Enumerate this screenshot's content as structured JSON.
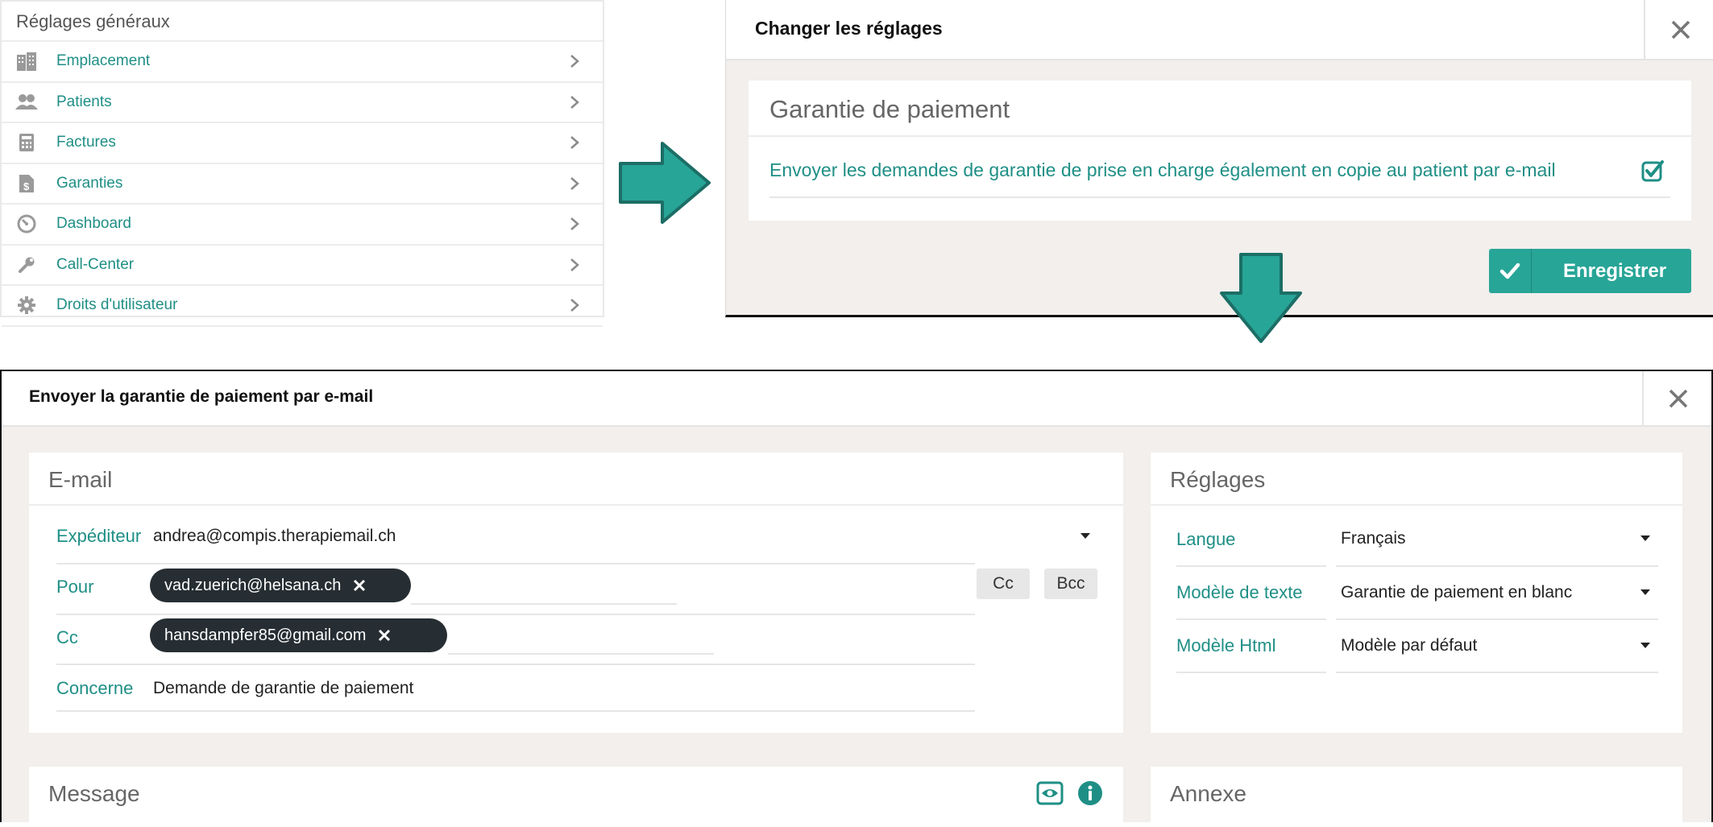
{
  "settings_list": {
    "header": "Réglages généraux",
    "items": [
      {
        "label": "Emplacement",
        "icon": "building-icon"
      },
      {
        "label": "Patients",
        "icon": "users-icon"
      },
      {
        "label": "Factures",
        "icon": "calculator-icon"
      },
      {
        "label": "Garanties",
        "icon": "document-dollar-icon"
      },
      {
        "label": "Dashboard",
        "icon": "dashboard-icon"
      },
      {
        "label": "Call-Center",
        "icon": "wrench-icon"
      },
      {
        "label": "Droits d'utilisateur",
        "icon": "gear-icon"
      }
    ]
  },
  "change_settings_modal": {
    "title": "Changer les réglages",
    "panel_title": "Garantie de paiement",
    "option_label": "Envoyer les demandes de garantie de prise en charge également en copie au patient par e-mail",
    "option_checked": true,
    "save_label": "Enregistrer"
  },
  "email_modal": {
    "title": "Envoyer la garantie de paiement par e-mail",
    "email_card": {
      "title": "E-mail",
      "sender_label": "Expéditeur",
      "sender_value": "andrea@compis.therapiemail.ch",
      "to_label": "Pour",
      "to_chips": [
        "vad.zuerich@helsana.ch"
      ],
      "cc_button": "Cc",
      "bcc_button": "Bcc",
      "cc_label": "Cc",
      "cc_chips": [
        "hansdampfer85@gmail.com"
      ],
      "subject_label": "Concerne",
      "subject_value": "Demande de garantie de paiement"
    },
    "settings_card": {
      "title": "Réglages",
      "language_label": "Langue",
      "language_value": "Français",
      "text_template_label": "Modèle de texte",
      "text_template_value": "Garantie de paiement en blanc",
      "html_template_label": "Modèle Html",
      "html_template_value": "Modèle par défaut"
    },
    "message_card": {
      "title": "Message"
    },
    "attachment_card": {
      "title": "Annexe"
    }
  },
  "colors": {
    "accent": "#1f8f86",
    "button": "#27a597",
    "arrow": "#27a597",
    "chip": "#262e33",
    "modal_background": "#f2efec"
  }
}
